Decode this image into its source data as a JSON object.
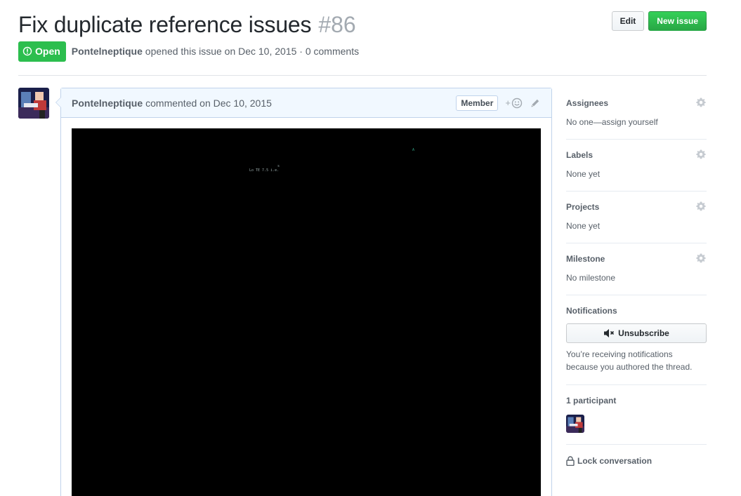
{
  "issue": {
    "title": "Fix duplicate reference issues",
    "number": "#86",
    "state": "Open",
    "author": "Pontelneptique",
    "opened_text": "opened this issue on Dec 10, 2015 · 0 comments"
  },
  "header_actions": {
    "edit_label": "Edit",
    "new_issue_label": "New issue"
  },
  "comment": {
    "author": "Pontelneptique",
    "timestamp_text": "commented on Dec 10, 2015",
    "role_label": "Member",
    "reaction_label": "+",
    "image_specks": [
      "Lo TE 7.5 i.e.",
      "s",
      "A"
    ]
  },
  "sidebar": {
    "assignees": {
      "heading": "Assignees",
      "value": "No one—assign yourself"
    },
    "labels": {
      "heading": "Labels",
      "value": "None yet"
    },
    "projects": {
      "heading": "Projects",
      "value": "None yet"
    },
    "milestone": {
      "heading": "Milestone",
      "value": "No milestone"
    },
    "notifications": {
      "heading": "Notifications",
      "button_label": "Unsubscribe",
      "reason": "You’re receiving notifications because you authored the thread."
    },
    "participants": {
      "heading": "1 participant"
    },
    "lock_label": "Lock conversation"
  },
  "colors": {
    "open_green": "#2cbe4e",
    "comment_border": "#c0d3eb",
    "comment_header_bg": "#f1f8ff"
  }
}
